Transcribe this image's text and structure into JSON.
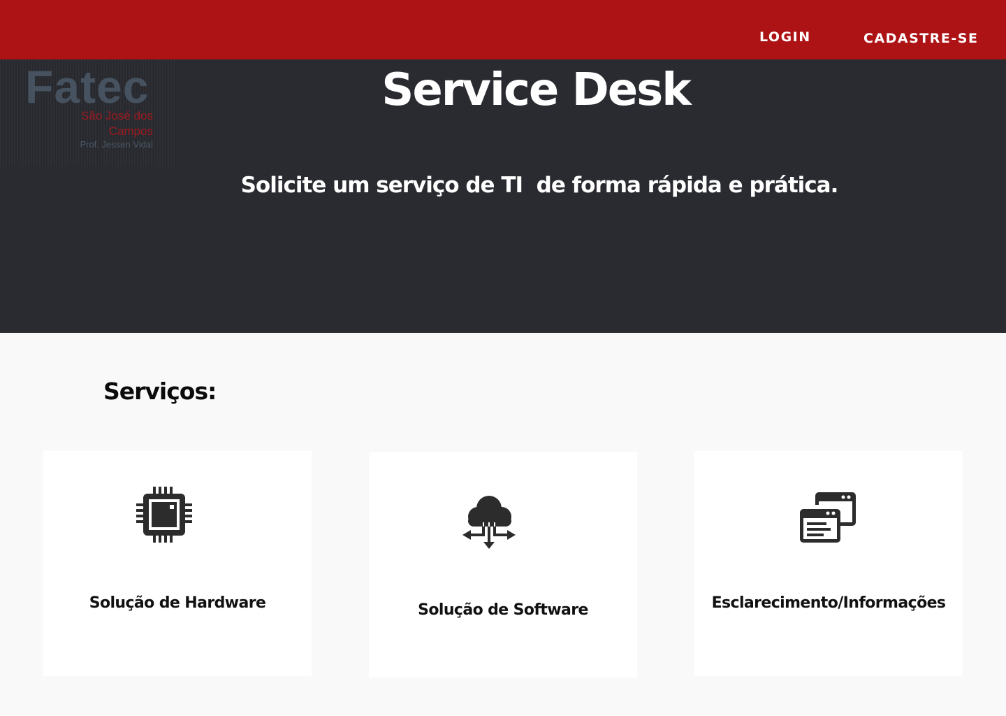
{
  "header": {
    "login_label": "LOGIN",
    "signup_label": "CADASTRE-SE",
    "accent_color": "#ad1315"
  },
  "logo": {
    "word": "Fatec",
    "city": "São José dos Campos",
    "subtitle": "Prof. Jessen Vidal"
  },
  "hero": {
    "title": "Service Desk",
    "subtitle": "Solicite um serviço de TI  de forma rápida e prática.",
    "background_color": "#292b31"
  },
  "services": {
    "title": "Serviços:",
    "cards": [
      {
        "label": "Solução de Hardware",
        "icon": "cpu-chip-icon"
      },
      {
        "label": "Solução de Software",
        "icon": "cloud-arrows-icon"
      },
      {
        "label": "Esclarecimento/Informações",
        "icon": "browser-windows-icon"
      }
    ]
  }
}
